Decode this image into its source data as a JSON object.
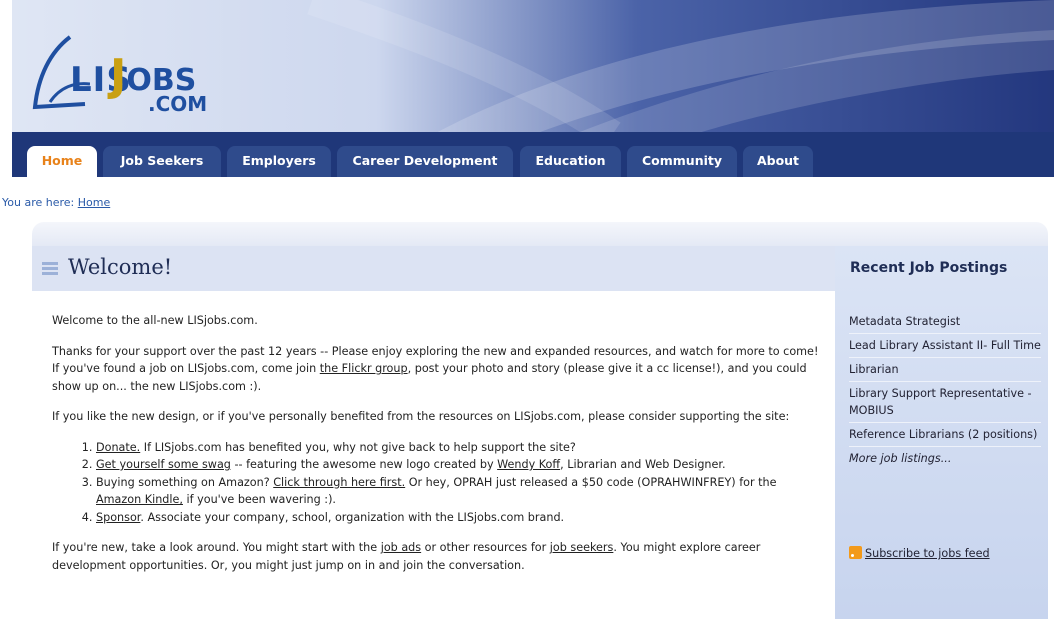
{
  "colors": {
    "nav_bg": "#1f3779",
    "tab_bg": "#2f4b8c",
    "active_tab_text": "#e8821a",
    "link": "#2a5aa8",
    "sidebar_bg": "#d3ddf2",
    "rss_orange": "#f39a1b"
  },
  "logo": {
    "lis": "LIS",
    "jobs_j": "J",
    "jobs_rest": "OBS",
    "com": ".COM"
  },
  "nav": {
    "tabs": [
      {
        "label": "Home"
      },
      {
        "label": "Job Seekers"
      },
      {
        "label": "Employers"
      },
      {
        "label": "Career Development"
      },
      {
        "label": "Education"
      },
      {
        "label": "Community"
      },
      {
        "label": "About"
      }
    ]
  },
  "breadcrumb": {
    "prefix": "You are here: ",
    "current": "Home"
  },
  "main": {
    "title": "Welcome!",
    "intro": "Welcome to the all-new LISjobs.com.",
    "p1_a": "Thanks for your support over the past 12 years -- Please enjoy exploring the new and expanded resources, and watch for more to come! If you've found a job on LISjobs.com, come join ",
    "p1_link": "the Flickr group",
    "p1_b": ", post your photo and story (please give it a cc license!), and you could show up on... the new LISjobs.com :).",
    "p2": "If you like the new design, or if you've personally benefited from the resources on LISjobs.com, please consider supporting the site:",
    "list": {
      "i1_link": "Donate.",
      "i1_text": " If LISjobs.com has benefited you, why not give back to help support the site?",
      "i2_link": "Get yourself some swag",
      "i2_text": " -- featuring the awesome new logo created by ",
      "i2_link2": "Wendy Koff",
      "i2_text2": ", Librarian and Web Designer.",
      "i3_text": "Buying something on Amazon? ",
      "i3_link": "Click through here first.",
      "i3_text2": " Or hey, OPRAH just released a $50 code (OPRAHWINFREY) for the ",
      "i3_link2": "Amazon Kindle,",
      "i3_text3": " if you've been wavering :).",
      "i4_link": "Sponsor",
      "i4_text": ". Associate your company, school, organization with the LISjobs.com brand."
    },
    "p3_a": "If you're new, take a look around. You might start with the ",
    "p3_link1": "job ads",
    "p3_b": " or other resources for ",
    "p3_link2": "job seekers",
    "p3_c": ". You might explore career development opportunities. Or, you might just jump on in and join the conversation."
  },
  "sidebar": {
    "title": "Recent Job Postings",
    "postings": [
      "Metadata Strategist",
      "Lead Library Assistant II- Full Time",
      "Librarian",
      "Library Support Representative - MOBIUS",
      "Reference Librarians (2 positions)"
    ],
    "more": "More job listings...",
    "rss": "Subscribe to jobs feed"
  }
}
